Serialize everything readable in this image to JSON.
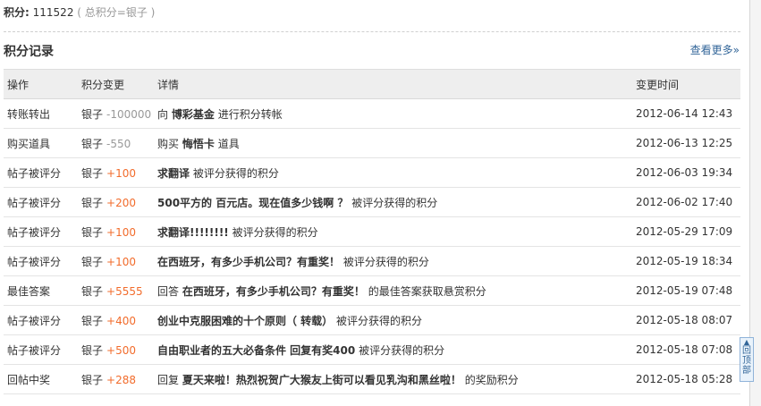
{
  "points": {
    "label": "积分:",
    "value": "111522",
    "note": "( 总积分=银子 )"
  },
  "section": {
    "title": "积分记录",
    "more_link": "查看更多»"
  },
  "table": {
    "headers": [
      "操作",
      "积分变更",
      "详情",
      "变更时间"
    ],
    "rows": [
      {
        "action": "转账转出",
        "currency": "银子",
        "amount": "-100000",
        "sign": "neg",
        "detail_pre": "向",
        "detail_bold": "博彩基金",
        "detail_post": "进行积分转帐",
        "time": "2012-06-14 12:43"
      },
      {
        "action": "购买道具",
        "currency": "银子",
        "amount": "-550",
        "sign": "neg",
        "detail_pre": "购买",
        "detail_bold": "悔悟卡",
        "detail_post": "道具",
        "time": "2012-06-13 12:25"
      },
      {
        "action": "帖子被评分",
        "currency": "银子",
        "amount": "+100",
        "sign": "pos",
        "detail_pre": "",
        "detail_bold": "求翻译",
        "detail_post": "被评分获得的积分",
        "time": "2012-06-03 19:34"
      },
      {
        "action": "帖子被评分",
        "currency": "银子",
        "amount": "+200",
        "sign": "pos",
        "detail_pre": "",
        "detail_bold": "500平方的 百元店。现在值多少钱啊 ？",
        "detail_post": "被评分获得的积分",
        "time": "2012-06-02 17:40"
      },
      {
        "action": "帖子被评分",
        "currency": "银子",
        "amount": "+100",
        "sign": "pos",
        "detail_pre": "",
        "detail_bold": "求翻译!!!!!!!!",
        "detail_post": "被评分获得的积分",
        "time": "2012-05-29 17:09"
      },
      {
        "action": "帖子被评分",
        "currency": "银子",
        "amount": "+100",
        "sign": "pos",
        "detail_pre": "",
        "detail_bold": "在西班牙，有多少手机公司？有重奖！",
        "detail_post": "被评分获得的积分",
        "time": "2012-05-19 18:34"
      },
      {
        "action": "最佳答案",
        "currency": "银子",
        "amount": "+5555",
        "sign": "pos",
        "detail_pre": "回答",
        "detail_bold": "在西班牙，有多少手机公司？有重奖！",
        "detail_post": "的最佳答案获取悬赏积分",
        "time": "2012-05-19 07:48"
      },
      {
        "action": "帖子被评分",
        "currency": "银子",
        "amount": "+400",
        "sign": "pos",
        "detail_pre": "",
        "detail_bold": "创业中克服困难的十个原则（ 转载）",
        "detail_post": "被评分获得的积分",
        "time": "2012-05-18 08:07"
      },
      {
        "action": "帖子被评分",
        "currency": "银子",
        "amount": "+500",
        "sign": "pos",
        "detail_pre": "",
        "detail_bold": "自由职业者的五大必备条件 回复有奖400",
        "detail_post": "被评分获得的积分",
        "time": "2012-05-18 07:08"
      },
      {
        "action": "回帖中奖",
        "currency": "银子",
        "amount": "+288",
        "sign": "pos",
        "detail_pre": "回复",
        "detail_bold": "夏天来啦！热烈祝贺广大猴友上街可以看见乳沟和黑丝啦！",
        "detail_post": "的奖励积分",
        "time": "2012-05-18 05:28"
      }
    ]
  },
  "back_to_top": {
    "line1": "回",
    "line2": "顶",
    "line3": "部"
  },
  "colors": {
    "positive": "#f26c2c",
    "negative": "#999999",
    "link": "#336699",
    "header_bg": "#eeeeee"
  }
}
